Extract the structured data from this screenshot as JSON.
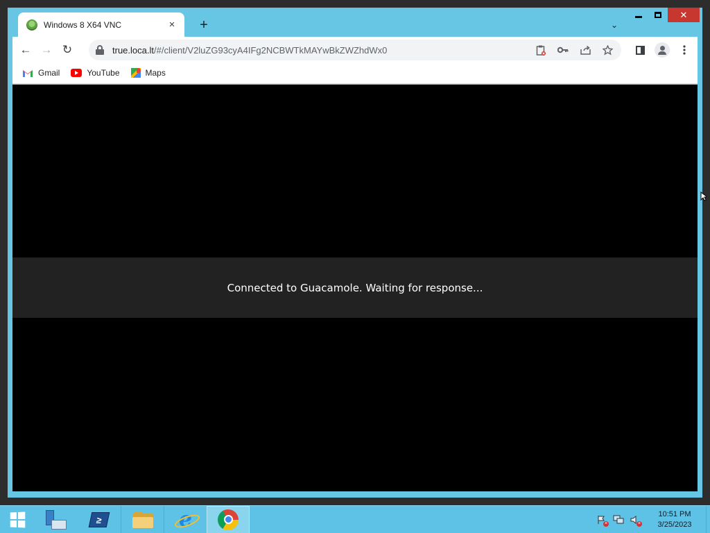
{
  "window": {
    "minimize_icon": "minimize-icon",
    "maximize_icon": "maximize-icon",
    "close_icon": "close-icon"
  },
  "browser": {
    "tab": {
      "title": "Windows 8 X64 VNC",
      "favicon": "guacamole-favicon",
      "close_label": "×"
    },
    "new_tab_label": "+",
    "tab_search_label": "⌄",
    "toolbar": {
      "back_label": "←",
      "forward_label": "→",
      "reload_label": "↻"
    },
    "omnibox": {
      "url_host": "true.loca.lt",
      "url_rest": "/#/client/V2luZG93cyA4IFg2NCBWTkMAYwBkZWZhdWx0"
    },
    "bookmarks": [
      {
        "label": "Gmail",
        "icon": "gmail-icon"
      },
      {
        "label": "YouTube",
        "icon": "youtube-icon"
      },
      {
        "label": "Maps",
        "icon": "maps-icon"
      }
    ]
  },
  "content": {
    "notification": "Connected to Guacamole. Waiting for response..."
  },
  "taskbar": {
    "apps": [
      "server-manager",
      "powershell",
      "file-explorer",
      "internet-explorer",
      "google-chrome"
    ],
    "active_app": "google-chrome",
    "powershell_glyph": "≥",
    "ie_glyph": "e",
    "clock": {
      "time": "10:51 PM",
      "date": "3/25/2023"
    }
  },
  "colors": {
    "window_frame": "#67c6e3",
    "taskbar": "#5ec2e6",
    "close_button": "#c7372f",
    "notification_bg": "#222222"
  }
}
